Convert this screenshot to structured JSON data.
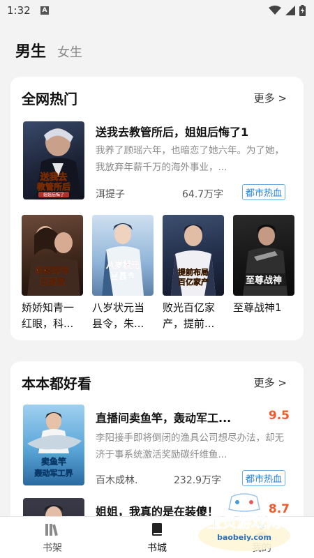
{
  "status": {
    "time": "1:32",
    "notif_letter": "A"
  },
  "gender_tabs": [
    {
      "label": "男生",
      "active": true
    },
    {
      "label": "女生",
      "active": false
    }
  ],
  "section1": {
    "title": "全网热门",
    "more": "更多 >",
    "featured": {
      "title": "送我去教管所后，姐姐后悔了1",
      "description": "我养了顾瑶六年，也暗恋了她六年。为了她，我放弃年薪千万的海外事业，...",
      "author": "洱提子",
      "words": "64.7万字",
      "tag": "都市热血",
      "cover_text": [
        "送我去",
        "教管所后",
        "姐姐后悔了"
      ]
    },
    "grid": [
      {
        "title": "娇娇知青一红眼，科...",
        "cover_text": [
          "科研军爷",
          "日夜宠"
        ]
      },
      {
        "title": "八岁状元当县令，朱...",
        "cover_text": [
          "八岁状元",
          "当县令"
        ]
      },
      {
        "title": "败光百亿家产，提前...",
        "cover_text": [
          "提前布局",
          "百亿家产"
        ]
      },
      {
        "title": "至尊战神1",
        "cover_text": [
          "至尊战神"
        ]
      }
    ]
  },
  "section2": {
    "title": "本本都好看",
    "more": "更多 >",
    "books": [
      {
        "title": "直播间卖鱼竿，轰动军工...",
        "score": "9.5",
        "description": "李阳接手即将倒闭的渔具公司想尽办法，却无济于事系统激活奖励碳纤维鱼...",
        "author": "百木成林.",
        "words": "232.9万字",
        "tag": "都市热血",
        "cover_text": [
          "卖鱼竿",
          "轰动军工界"
        ]
      },
      {
        "title": "姐姐，我真的是在装傻！",
        "score": "8.7"
      }
    ]
  },
  "tabbar": [
    {
      "label": "书架",
      "icon": "bookshelf-icon",
      "active": false
    },
    {
      "label": "书城",
      "icon": "book-icon",
      "active": true
    },
    {
      "label": "我的",
      "icon": "profile-icon",
      "active": false
    }
  ],
  "watermark": {
    "line1": "宝贝游戏网",
    "line2": "baobeiy.com"
  },
  "colors": {
    "tag_blue": "#2a7fd4",
    "score_orange": "#ef5b2a",
    "background": "#f3f3f3"
  }
}
